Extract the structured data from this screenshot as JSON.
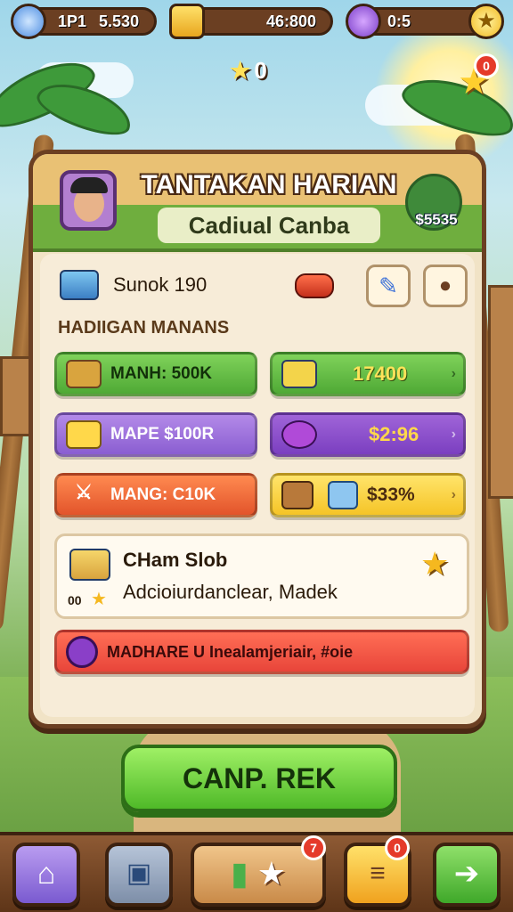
{
  "hud": {
    "player_label": "1P1",
    "player_value": "5.530",
    "gold_value": "46:800",
    "gem_value": "0:5",
    "stars_value": "0"
  },
  "panel": {
    "title": "TANTAKAN HARIAN",
    "subtitle": "Cadiual Canba",
    "reward_amount": "$5535",
    "item_label": "Sunok 190",
    "section_header": "HADIIGAN MANANS",
    "rows": [
      {
        "left": "MANH: 500K",
        "right": "17400"
      },
      {
        "left": "MAPE $100R",
        "right": "$2:96"
      },
      {
        "left": "MANG: C10K",
        "right": "$33%"
      }
    ],
    "info": {
      "title": "CHam Slob",
      "desc": "Adcioiurdanclear, Madek",
      "count": "00"
    },
    "footer_text": "MADHARE U Inealamjeriair, #oie"
  },
  "cta_label": "CANP. REK",
  "nav": {
    "badge_1": "7",
    "badge_2": "0"
  },
  "notification_badge": "0",
  "colors": {
    "accent": "#4fb928",
    "frame": "#6b3f22",
    "gold": "#f5c427"
  }
}
